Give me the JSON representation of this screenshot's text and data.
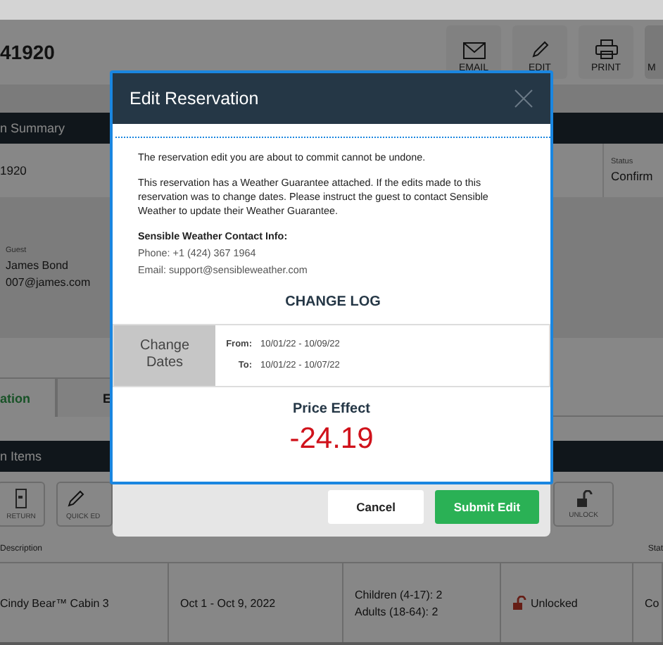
{
  "page": {
    "reservation_number": "41920",
    "toolbar": [
      {
        "label": "EMAIL",
        "kind": "email"
      },
      {
        "label": "EDIT",
        "kind": "edit"
      },
      {
        "label": "PRINT",
        "kind": "print"
      },
      {
        "label": "M",
        "kind": "more"
      }
    ],
    "summary_bar": "n Summary",
    "summary": {
      "reservation": "1920",
      "status_label": "Status",
      "status": "Confirm"
    },
    "guest": {
      "label": "Guest",
      "name": "James Bond",
      "email": "007@james.com"
    },
    "tabs": [
      {
        "label": "ation",
        "selected": true
      },
      {
        "label": "E",
        "selected": false
      }
    ],
    "items_bar": "n Items",
    "item_actions": [
      {
        "label": "RETURN",
        "kind": "return"
      },
      {
        "label": "QUICK ED",
        "kind": "edit"
      },
      {
        "label": "UNLOCK",
        "kind": "unlock"
      }
    ],
    "description_header": "Description",
    "status_header": "Stat",
    "row": {
      "description": "Cindy Bear™ Cabin 3",
      "dates": "Oct 1 - Oct 9, 2022",
      "guests": [
        "Children (4-17): 2",
        "Adults (18-64): 2"
      ],
      "lock": "Unlocked",
      "locked": false,
      "status": "Co"
    }
  },
  "modal": {
    "title": "Edit Reservation",
    "warning": "The reservation edit you are about to commit cannot be undone.",
    "notice": "This reservation has a Weather Guarantee attached. If the edits made to this reservation was to change dates. Please instruct the guest to contact Sensible Weather to update their Weather Guarantee.",
    "contact_title": "Sensible Weather Contact Info:",
    "phone": "Phone: +1 (424) 367 1964",
    "email": "Email: support@sensibleweather.com",
    "change_log_title": "CHANGE LOG",
    "change": {
      "type": "Change Dates",
      "from_label": "From:",
      "from": "10/01/22 - 10/09/22",
      "to_label": "To:",
      "to": "10/01/22 - 10/07/22"
    },
    "price_title": "Price Effect",
    "price": "-24.19",
    "buttons": [
      {
        "label": "Cancel",
        "kind": "secondary"
      },
      {
        "label": "Submit Edit",
        "kind": "primary"
      }
    ]
  }
}
